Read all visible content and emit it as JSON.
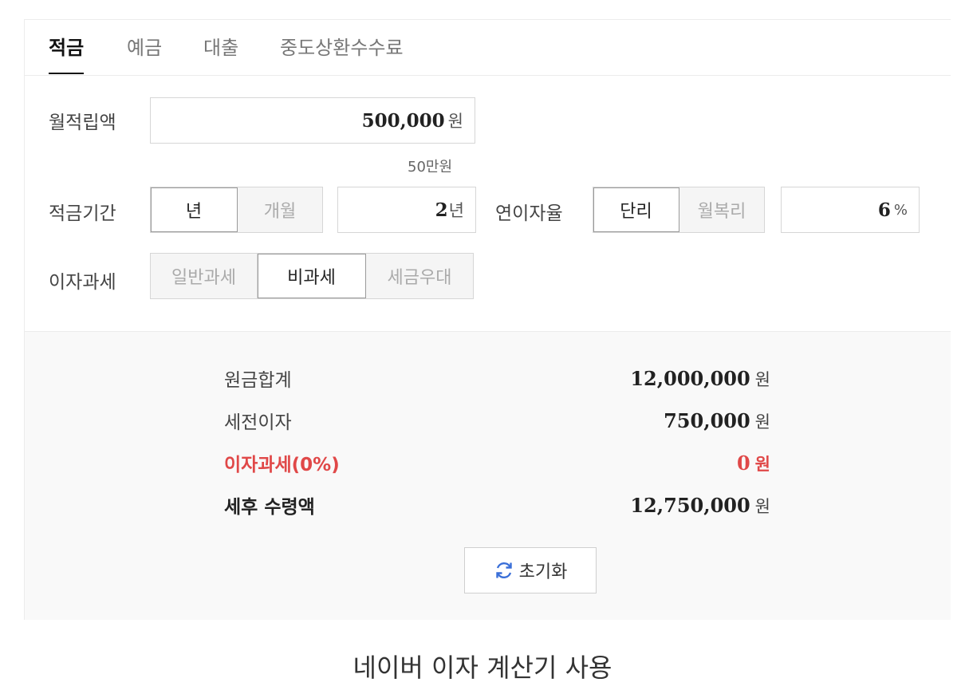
{
  "tabs": [
    {
      "label": "적금",
      "active": true
    },
    {
      "label": "예금",
      "active": false
    },
    {
      "label": "대출",
      "active": false
    },
    {
      "label": "중도상환수수료",
      "active": false
    }
  ],
  "form": {
    "monthly": {
      "label": "월적립액",
      "value": "500,000",
      "unit": "원",
      "hint": "50만원"
    },
    "period": {
      "label": "적금기간",
      "options": [
        "년",
        "개월"
      ],
      "selected": "년",
      "value": "2",
      "unit": "년"
    },
    "rate": {
      "label": "연이자율",
      "options": [
        "단리",
        "월복리"
      ],
      "selected": "단리",
      "value": "6",
      "unit": "%"
    },
    "tax": {
      "label": "이자과세",
      "options": [
        "일반과세",
        "비과세",
        "세금우대"
      ],
      "selected": "비과세"
    }
  },
  "results": [
    {
      "label": "원금합계",
      "value": "12,000,000",
      "unit": "원"
    },
    {
      "label": "세전이자",
      "value": "750,000",
      "unit": "원"
    },
    {
      "label": "이자과세(0%)",
      "value": "0",
      "unit": "원"
    },
    {
      "label": "세후 수령액",
      "value": "12,750,000",
      "unit": "원"
    }
  ],
  "reset_label": "초기화",
  "caption": "네이버 이자 계산기 사용",
  "colors": {
    "accent_red": "#e04848",
    "icon_blue": "#3a6fd8"
  }
}
